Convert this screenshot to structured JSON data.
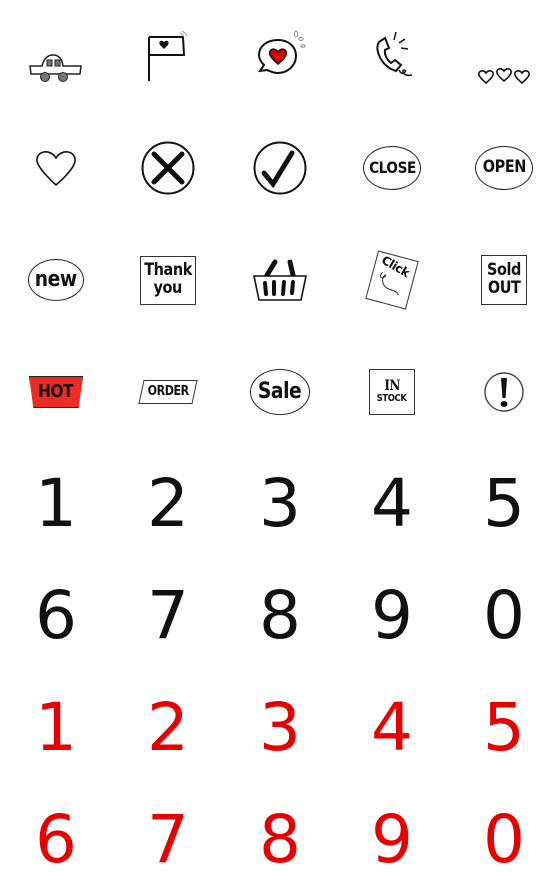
{
  "stickers": {
    "car": "car-icon",
    "flag": "heart-flag-icon",
    "speech_heart": "heart-speech-bubble-icon",
    "phone": "ringing-phone-icon",
    "three_hearts": "three-hearts-icon",
    "heart": "heart-outline-icon",
    "cross": "cross-circle-icon",
    "check": "check-circle-icon",
    "close_label": "CLOSE",
    "open_label": "OPEN",
    "new_label": "new",
    "thank_line1": "Thank",
    "thank_line2": "you",
    "basket": "shopping-basket-icon",
    "click_label": "Click",
    "sold_line1": "Sold",
    "sold_line2": "OUT",
    "hot_label": "HOT",
    "order_label": "ORDER",
    "sale_label": "Sale",
    "in_label": "IN",
    "stock_label": "STOCK",
    "exclaim": "exclamation-circle-icon"
  },
  "black_digits": [
    "1",
    "2",
    "3",
    "4",
    "5",
    "6",
    "7",
    "8",
    "9",
    "0"
  ],
  "red_digits": [
    "1",
    "2",
    "3",
    "4",
    "5",
    "6",
    "7",
    "8",
    "9",
    "0"
  ],
  "colors": {
    "red": "#e60000",
    "ink": "#111111",
    "hot_bg": "#ee2a24"
  }
}
